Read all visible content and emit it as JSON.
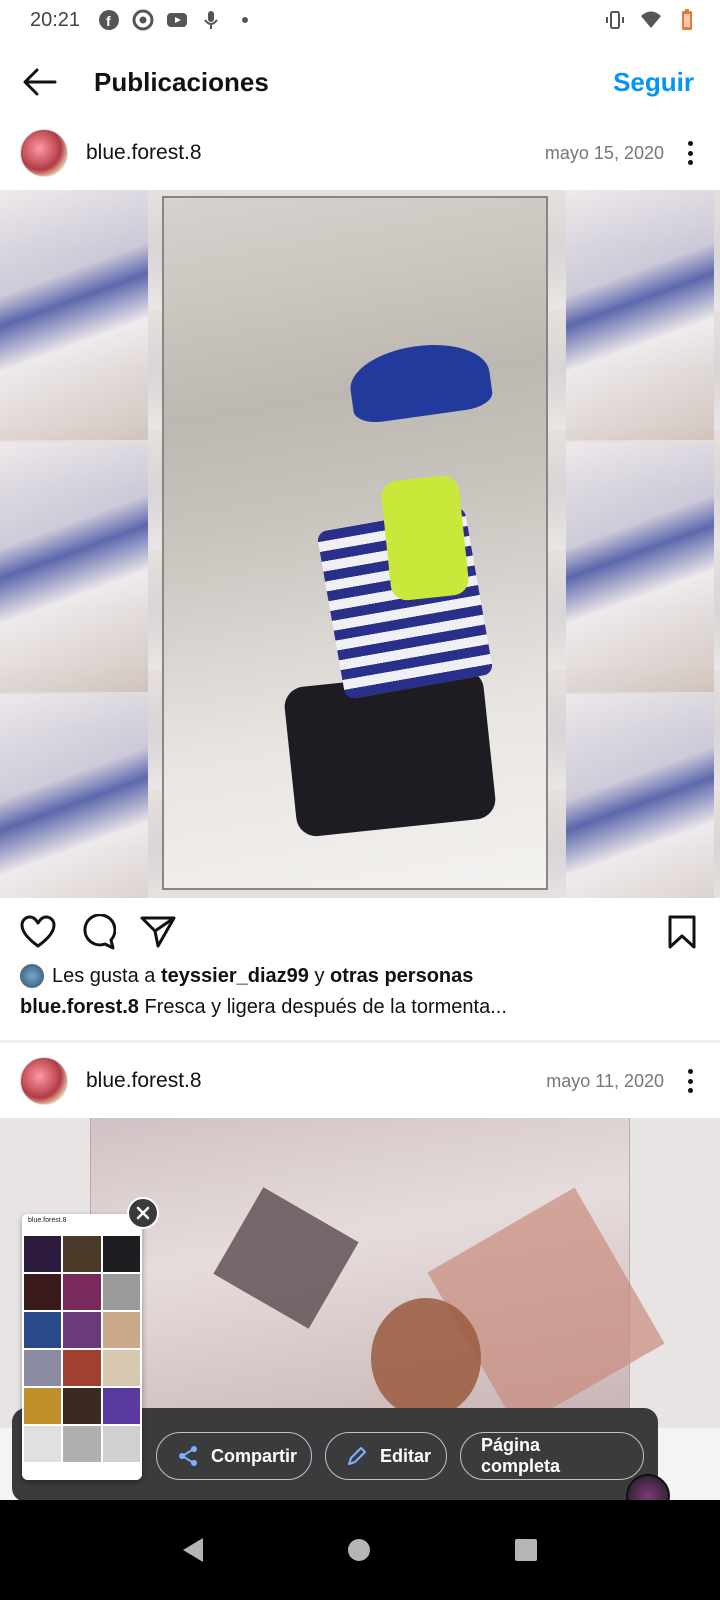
{
  "status_bar": {
    "time": "20:21"
  },
  "topbar": {
    "title": "Publicaciones",
    "follow_label": "Seguir"
  },
  "posts": [
    {
      "username": "blue.forest.8",
      "date": "mayo 15, 2020"
    },
    {
      "username": "blue.forest.8",
      "date": "mayo 11, 2020"
    }
  ],
  "likes": {
    "prefix": "Les gusta a",
    "user": "teyssier_diaz99",
    "joiner": "y",
    "others": "otras personas"
  },
  "caption": {
    "username": "blue.forest.8",
    "text": "Fresca y ligera después de la tormenta..."
  },
  "screenshot_toolbar": {
    "share_label": "Compartir",
    "edit_label": "Editar",
    "full_page_label": "Página completa"
  },
  "thumbnail": {
    "header_text": "blue.forest.8"
  },
  "icons": {
    "status": [
      "facebook-icon",
      "chrome-icon",
      "youtube-icon",
      "mic-icon",
      "dot-icon",
      "vibrate-icon",
      "wifi-icon",
      "battery-icon"
    ],
    "actions": [
      "heart-icon",
      "comment-icon",
      "send-icon",
      "bookmark-icon"
    ]
  },
  "colors": {
    "accent": "#0095f6",
    "toolbar_bg": "#3a3b3d",
    "nav_bg": "#000000"
  }
}
